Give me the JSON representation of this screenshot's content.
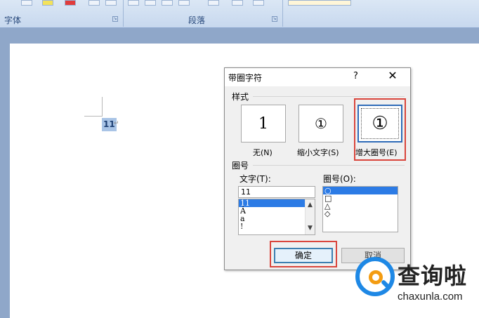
{
  "ribbon": {
    "group_font_label": "字体",
    "group_paragraph_label": "段落"
  },
  "document": {
    "selected_text": "11",
    "paragraph_mark": "↵"
  },
  "dialog": {
    "title": "带圈字符",
    "help": "?",
    "close": "✕",
    "style_section": "样式",
    "styles": [
      {
        "preview": "1",
        "label": "无(N)"
      },
      {
        "preview": "①",
        "label": "缩小文字(S)"
      },
      {
        "preview": "①",
        "label": "增大圈号(E)"
      }
    ],
    "enclosure_section": "圈号",
    "text_label": "文字(T):",
    "text_value": "11",
    "text_list": [
      "11",
      "Á",
      "a",
      "!"
    ],
    "enclosure_label": "圈号(O):",
    "enclosure_list": [
      "○",
      "□",
      "△",
      "◇"
    ],
    "ok_label": "确定",
    "cancel_label": "取消"
  },
  "watermark": {
    "text": "查询啦",
    "sub": "chaxunla.com"
  },
  "colors": {
    "highlight_frame": "#d9453c",
    "selection": "#2c7be5"
  }
}
